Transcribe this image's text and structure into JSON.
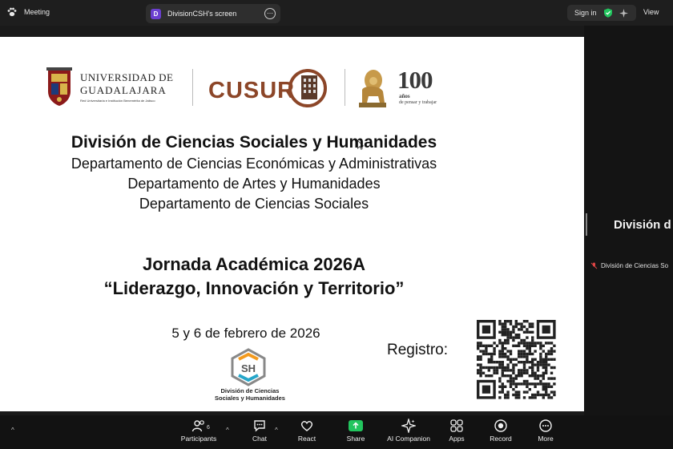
{
  "topbar": {
    "meeting_label": "Meeting",
    "screen_tab_badge": "D",
    "screen_tab_label": "DivisionCSH's screen",
    "signin_label": "Sign in",
    "view_label": "View"
  },
  "slide": {
    "udg_name_line1": "UNIVERSIDAD DE",
    "udg_name_line2": "GUADALAJARA",
    "udg_sub": "Red Universitaria e Institución Benemérita de Jalisco",
    "cusur_logo": "CUSUR",
    "centenary_number": "100",
    "centenary_line1": "años",
    "centenary_line2": "de pensar y trabajar",
    "division_title": "División de Ciencias Sociales y Humanidades",
    "department_1": "Departamento de Ciencias Económicas y Administrativas",
    "department_2": "Departamento de Artes y Humanidades",
    "department_3": "Departamento de Ciencias Sociales",
    "event_title": "Jornada Académica 2026A",
    "event_subtitle": "“Liderazgo, Innovación y Territorio”",
    "dates": "5 y 6 de febrero de 2026",
    "registro_label": "Registro:",
    "csh_caption_line1": "División de Ciencias",
    "csh_caption_line2": "Sociales y Humanidades"
  },
  "right_panel": {
    "participant_name": "División d",
    "participant_label": "División de Ciencias So"
  },
  "toolbar": {
    "participants_label": "Participants",
    "participants_count": "6",
    "chat_label": "Chat",
    "react_label": "React",
    "share_label": "Share",
    "ai_label": "AI Companion",
    "apps_label": "Apps",
    "record_label": "Record",
    "more_label": "More"
  },
  "colors": {
    "share_green": "#22c55e",
    "cusur_brown": "#8c4628",
    "badge_purple": "#6b3fd0",
    "shield_green": "#22c55e"
  }
}
